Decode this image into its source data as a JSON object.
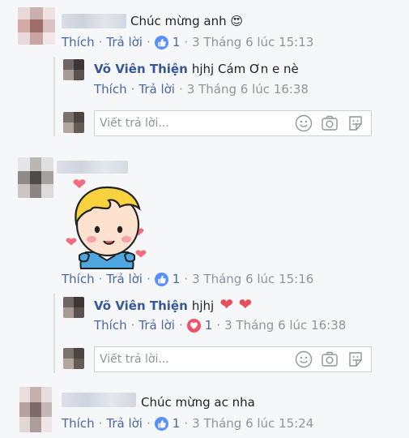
{
  "labels": {
    "like": "Thích",
    "reply": "Trả lời",
    "separator": "·",
    "reply_placeholder": "Viết trả lời..."
  },
  "comments": [
    {
      "text": "Chúc mừng anh",
      "emoji": "😍",
      "reaction_icon": "like-icon",
      "reaction_count": "1",
      "timestamp": "3 Tháng 6 lúc 15:13",
      "reply": {
        "author": "Võ Viên Thiện",
        "text": "hjhj Cám Ơn e nè",
        "timestamp": "3 Tháng 6 lúc 16:38"
      }
    },
    {
      "sticker": "boy-with-hearts-sticker",
      "reaction_icon": "like-icon",
      "reaction_count": "1",
      "timestamp": "3 Tháng 6 lúc 15:16",
      "reply": {
        "author": "Võ Viên Thiện",
        "text": "hjhj",
        "hearts": "❤ ❤",
        "reaction_icon": "love-icon",
        "reaction_count": "1",
        "timestamp": "3 Tháng 6 lúc 16:38"
      }
    },
    {
      "text": "Chúc mừng ac nha",
      "reaction_icon": "like-icon",
      "reaction_count": "1",
      "timestamp": "3 Tháng 6 lúc 15:24"
    }
  ],
  "colors": {
    "background": "#f6f7f9",
    "link": "#4b67a1",
    "author": "#365899",
    "meta": "#90949c",
    "like_blue": "#5890ff",
    "love_red": "#f25268"
  }
}
